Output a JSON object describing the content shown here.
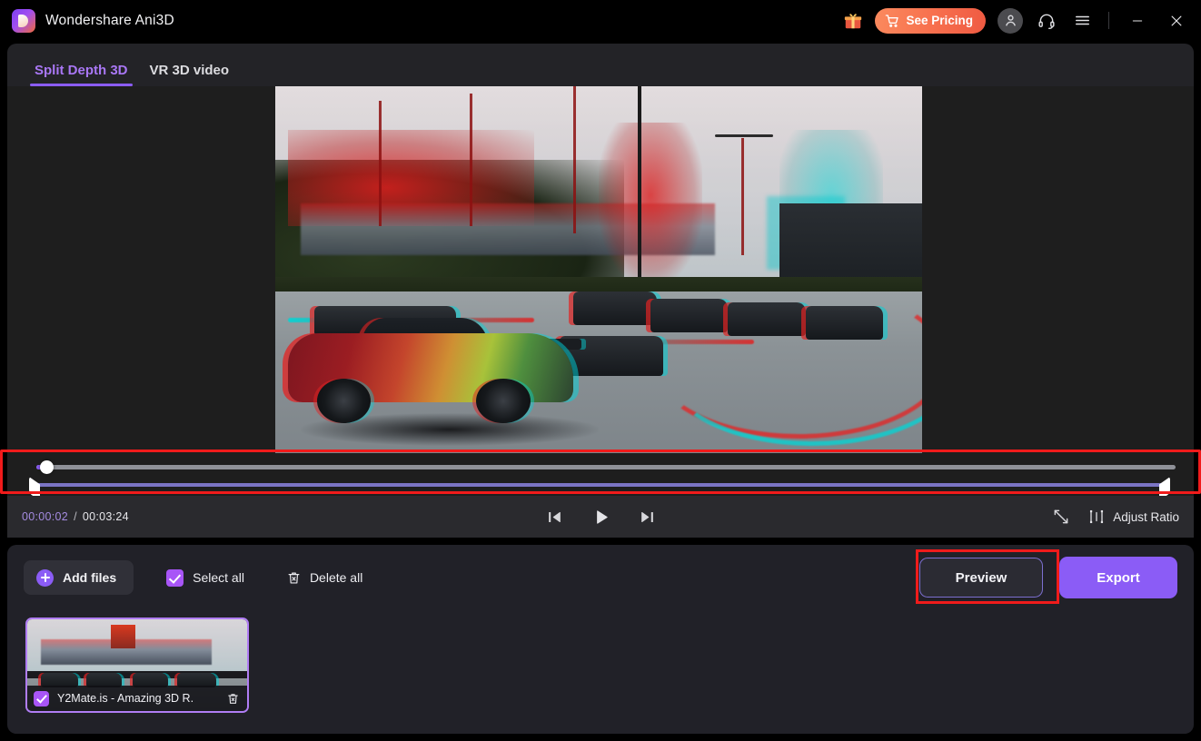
{
  "window": {
    "title": "Wondershare Ani3D",
    "logo_icon": "wondershare-logo-icon",
    "controls": {
      "gift_icon": "gift-icon",
      "pricing_label": "See Pricing",
      "cart_icon": "cart-icon",
      "account_icon": "user-account-icon",
      "support_icon": "headset-support-icon",
      "menu_icon": "hamburger-menu-icon",
      "minimize_icon": "minimize-icon",
      "close_icon": "close-icon"
    }
  },
  "tabs": [
    {
      "label": "Split Depth 3D",
      "active": true
    },
    {
      "label": "VR 3D video",
      "active": false
    }
  ],
  "player": {
    "preview_alt": "anaglyph-3d-racing-video-frame",
    "timeline": {
      "progress_percent": 1,
      "playhead_icon": "playhead-knob",
      "trim_start_icon": "trim-start-handle",
      "trim_end_icon": "trim-end-handle"
    },
    "transport": {
      "current_time": "00:00:02",
      "separator": "/",
      "total_time": "00:03:24",
      "prev_frame_icon": "previous-frame-icon",
      "play_icon": "play-icon",
      "next_frame_icon": "next-frame-icon",
      "fullscreen_icon": "fullscreen-icon",
      "ratio_icon": "adjust-ratio-icon",
      "ratio_label": "Adjust Ratio"
    }
  },
  "bottom": {
    "add_files_label": "Add files",
    "add_files_icon": "plus-circle-icon",
    "select_all_label": "Select all",
    "select_all_checked": true,
    "delete_all_label": "Delete all",
    "delete_all_icon": "trash-icon",
    "preview_label": "Preview",
    "export_label": "Export",
    "files": [
      {
        "name": "Y2Mate.is - Amazing 3D R.",
        "selected": true,
        "delete_icon": "delete-file-icon",
        "thumb_alt": "anaglyph-3d-race-track-thumbnail"
      }
    ]
  },
  "annotations": {
    "timeline_highlight_color": "#f01b1b",
    "preview_highlight_color": "#f01b1b"
  },
  "colors": {
    "accent_purple": "#8b5cf6",
    "pricing_orange": "#f8724f",
    "panel_bg": "#212128",
    "player_bg": "#1e1e1e"
  }
}
